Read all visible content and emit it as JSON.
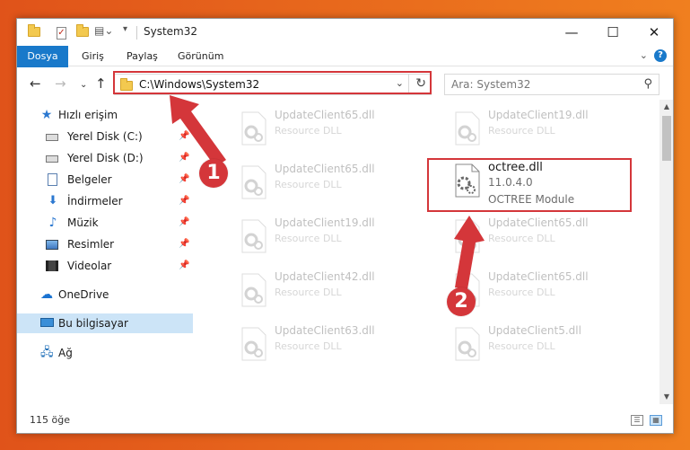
{
  "window": {
    "title": "System32",
    "controls": {
      "minimize": "—",
      "maximize": "☐",
      "close": "✕"
    }
  },
  "ribbon": {
    "tabs": [
      "Dosya",
      "Giriş",
      "Paylaş",
      "Görünüm"
    ],
    "expand": "⌄",
    "help": "?"
  },
  "navbar": {
    "back": "←",
    "forward": "→",
    "recent": "⌄",
    "up": "↑",
    "address": "C:\\Windows\\System32",
    "dropdown": "⌄",
    "refresh": "↻",
    "search_placeholder": "Ara: System32",
    "search_icon": "⚲"
  },
  "sidebar": {
    "items": [
      {
        "label": "Hızlı erişim",
        "icon": "star-icon",
        "pinned": false
      },
      {
        "label": "Yerel Disk (C:)",
        "icon": "drive-icon",
        "pinned": true
      },
      {
        "label": "Yerel Disk (D:)",
        "icon": "drive-icon",
        "pinned": true
      },
      {
        "label": "Belgeler",
        "icon": "document-icon",
        "pinned": true
      },
      {
        "label": "İndirmeler",
        "icon": "download-icon",
        "pinned": true
      },
      {
        "label": "Müzik",
        "icon": "music-icon",
        "pinned": true
      },
      {
        "label": "Resimler",
        "icon": "pictures-icon",
        "pinned": true
      },
      {
        "label": "Videolar",
        "icon": "videos-icon",
        "pinned": true
      },
      {
        "label": "OneDrive",
        "icon": "cloud-icon",
        "pinned": false
      },
      {
        "label": "Bu bilgisayar",
        "icon": "computer-icon",
        "pinned": false,
        "selected": true
      },
      {
        "label": "Ağ",
        "icon": "network-icon",
        "pinned": false
      }
    ],
    "pin_glyph": "📌"
  },
  "files": {
    "left": [
      {
        "name": "UpdateClient65.dll",
        "type": "Resource DLL"
      },
      {
        "name": "UpdateClient65.dll",
        "type": "Resource DLL"
      },
      {
        "name": "UpdateClient19.dll",
        "type": "Resource DLL"
      },
      {
        "name": "UpdateClient42.dll",
        "type": "Resource DLL"
      },
      {
        "name": "UpdateClient63.dll",
        "type": "Resource DLL"
      }
    ],
    "right": [
      {
        "name": "UpdateClient19.dll",
        "type": "Resource DLL"
      },
      {
        "name": "UpdateClient65.dll",
        "type": "Resource DLL"
      },
      {
        "name": "UpdateClient65.dll",
        "type": "Resource DLL"
      },
      {
        "name": "UpdateClient5.dll",
        "type": "Resource DLL"
      }
    ],
    "featured": {
      "name": "octree.dll",
      "version": "11.0.4.0",
      "description": "OCTREE Module"
    }
  },
  "status": {
    "count": "115 öğe"
  },
  "annotations": {
    "step1": "1",
    "step2": "2",
    "color": "#d4363a"
  }
}
